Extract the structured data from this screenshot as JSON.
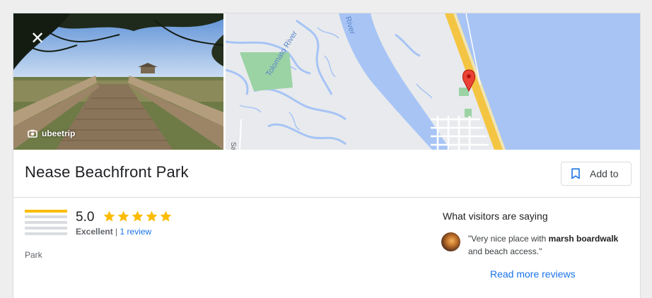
{
  "photo": {
    "credit": "ubeetrip"
  },
  "map": {
    "labels": {
      "river1": "Tolomato River",
      "river2": "River",
      "road": "Sa"
    },
    "colors": {
      "water": "#a7c4f5",
      "land": "#e8eaed",
      "beach_road": "#f4c542",
      "park": "#9bd3a4",
      "pin": "#ea4335"
    }
  },
  "place": {
    "name": "Nease Beachfront Park",
    "category": "Park"
  },
  "actions": {
    "add_to_label": "Add to"
  },
  "rating": {
    "score": "5.0",
    "stars": 5,
    "label": "Excellent",
    "separator": "|",
    "reviews_link": "1 review"
  },
  "visitors": {
    "heading": "What visitors are saying",
    "quote": {
      "before": "\"Very nice place with ",
      "bold": "marsh boardwalk",
      "after": " and beach access.\""
    },
    "read_more": "Read more reviews"
  },
  "colors": {
    "accent": "#1a73e8",
    "star": "#fbbc04"
  }
}
